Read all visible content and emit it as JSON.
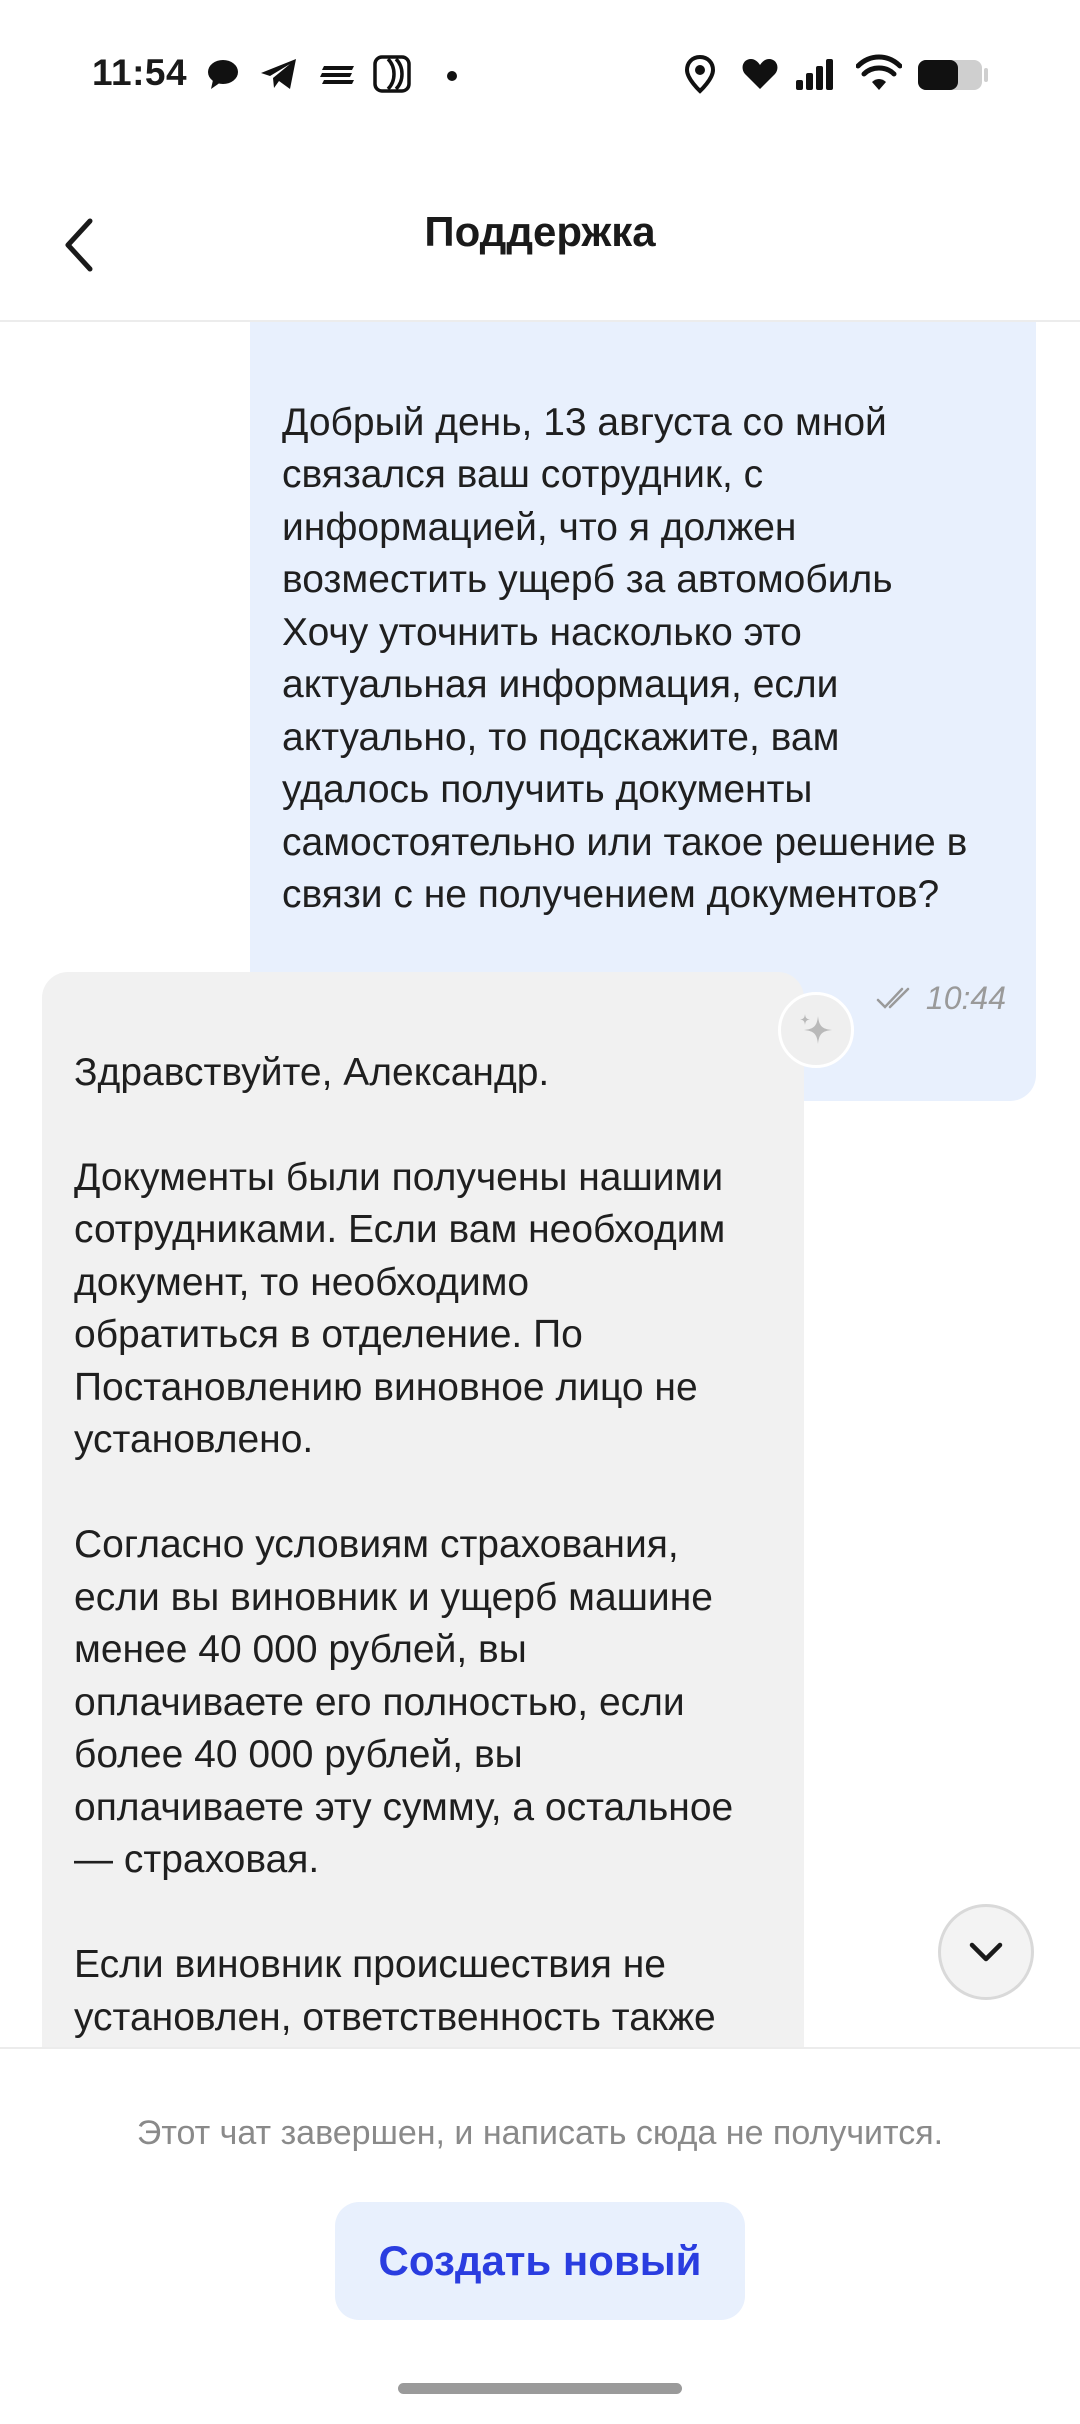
{
  "status_bar": {
    "time": "11:54"
  },
  "header": {
    "title": "Поддержка"
  },
  "messages": [
    {
      "direction": "outgoing",
      "text": "Добрый день, 13 августа со мной\nсвязался ваш сотрудник, с\nинформацией, что я должен\nвозместить ущерб за автомобиль\nХочу уточнить насколько это\nактуальная информация, если\nактуально, то подскажите, вам\nудалось получить документы\nсамостоятельно или такое решение в\nсвязи с не получением документов?",
      "time": "10:44"
    },
    {
      "direction": "incoming",
      "text": "Здравствуйте, Александр.\n\nДокументы были получены нашими\nсотрудниками. Если вам необходим\nдокумент, то необходимо\nобратиться в отделение. По\nПостановлению виновное лицо не\nустановлено.\n\nСогласно условиям страхования,\nесли вы виновник и ущерб машине\nменее 40 000 рублей, вы\nоплачиваете его полностью, если\nболее 40 000 рублей, вы\nоплачиваете эту сумму, а остальное\n— страховая.\n\nЕсли виновник происшествия не\nустановлен, ответственность также\nложится на вас."
    }
  ],
  "footer": {
    "closed_note": "Этот чат завершен, и написать сюда не получится.",
    "new_chat_button": "Создать новый"
  },
  "colors": {
    "outgoing_bubble": "#e8f0fd",
    "incoming_bubble": "#f1f1f1",
    "accent": "#2a3de0"
  }
}
